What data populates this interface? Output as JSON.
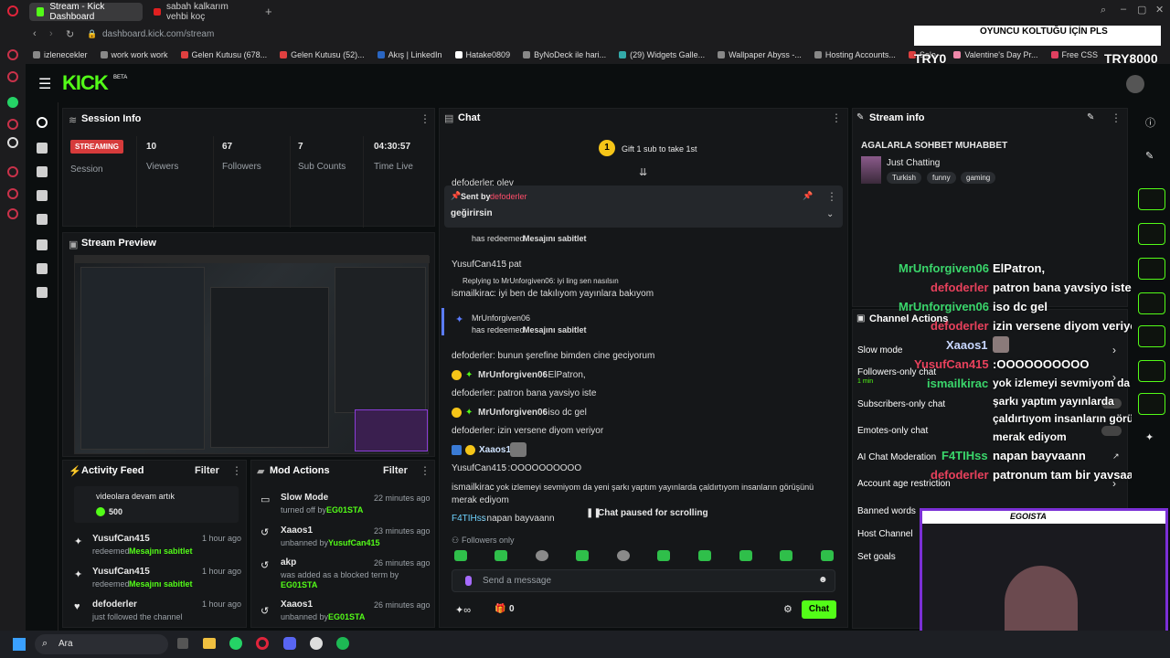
{
  "browser": {
    "tabs": [
      {
        "label": "Stream - Kick Dashboard"
      },
      {
        "label": "sabah kalkarım vehbi koç"
      }
    ],
    "url_host": "dashboard.kick.com",
    "url_path": "/stream",
    "bookmarks": [
      "izlenecekler",
      "work work work",
      "Gelen Kutusu (678...",
      "Gelen Kutusu (52)...",
      "Akış | LinkedIn",
      "Hatake0809",
      "ByNoDeck ile hari...",
      "(29) Widgets Galle...",
      "Wallpaper Abyss -...",
      "Hosting Accounts...",
      "Solo -",
      "Valentine's Day Pr...",
      "Free CSS"
    ]
  },
  "overlay_top": {
    "banner": "OYUNCU KOLTUĞU İÇİN PLS",
    "left": "TRY0",
    "right": "TRY8000"
  },
  "logo": {
    "text": "KICK",
    "beta": "BETA"
  },
  "session": {
    "title": "Session Info",
    "badge": "STREAMING",
    "session_label": "Session",
    "stats": [
      {
        "value": "10",
        "label": "Viewers"
      },
      {
        "value": "67",
        "label": "Followers"
      },
      {
        "value": "7",
        "label": "Sub Counts"
      },
      {
        "value": "04:30:57",
        "label": "Time Live"
      }
    ]
  },
  "preview": {
    "title": "Stream Preview"
  },
  "activity": {
    "title": "Activity Feed",
    "filter": "Filter",
    "top_text": "videolara devam artık",
    "top_amount": "500",
    "items": [
      {
        "name": "YusufCan415",
        "action": "redeemed",
        "reward": "Mesajını sabitlet",
        "time": "1 hour ago"
      },
      {
        "name": "YusufCan415",
        "action": "redeemed",
        "reward": "Mesajını sabitlet",
        "time": "1 hour ago"
      },
      {
        "name": "defoderler",
        "action": "just followed the channel",
        "reward": "",
        "time": "1 hour ago"
      }
    ]
  },
  "mod": {
    "title": "Mod Actions",
    "filter": "Filter",
    "items": [
      {
        "name": "Slow Mode",
        "line": "turned off by",
        "by": "EG01STA",
        "time": "22 minutes ago"
      },
      {
        "name": "Xaaos1",
        "line": "unbanned by",
        "by": "YusufCan415",
        "time": "23 minutes ago"
      },
      {
        "name": "akp",
        "line": "was added as a blocked term by",
        "by": "EG01STA",
        "time": "26 minutes ago"
      },
      {
        "name": "Xaaos1",
        "line": "unbanned by",
        "by": "EG01STA",
        "time": "26 minutes ago"
      }
    ]
  },
  "chat": {
    "title": "Chat",
    "gift_count": "1",
    "gift_text": "Gift 1 sub to take 1st",
    "partial_user": "defoderler",
    "partial_text": ": olev",
    "pinned_by_label": "Sent by",
    "pinned_by": "defoderler",
    "pinned_text": "geğirirsin",
    "redeem1_text": "has redeemed",
    "redeem1_reward": "Mesajını sabitlet",
    "messages": [
      {
        "user": "YusufCan415",
        "text": ": pat"
      },
      {
        "reply": "Replying to MrUnforgiven06: iyi ling sen nasılsın"
      },
      {
        "user": "ismailkirac",
        "text": ": iyi ben de takılıyom yayınlara bakıyom"
      }
    ],
    "redeem2_user": "MrUnforgiven06",
    "redeem2_text": "has redeemed",
    "redeem2_reward": "Mesajını sabitlet",
    "messages2": [
      {
        "user": "defoderler",
        "text": ": bunun şerefine bimden cine geciyorum"
      },
      {
        "user": "MrUnforgiven06",
        "text": ": ElPatron,"
      },
      {
        "user": "defoderler",
        "text": ": patron bana yavsiyo iste"
      },
      {
        "user": "MrUnforgiven06",
        "text": ": iso dc gel"
      },
      {
        "user": "defoderler",
        "text": ": izin versene diyom veriyor"
      },
      {
        "user": "Xaaos1",
        "text": ":"
      },
      {
        "user": "YusufCan415",
        "text": ": :OOOOOOOOOO"
      },
      {
        "user": "ismailkirac",
        "text": ": yok izlemeyi sevmiyom da yeni şarkı yaptım yayınlarda çaldırtıyom insanların görüşünü"
      },
      {
        "cont": "merak ediyom"
      },
      {
        "user": "F4TIHss",
        "text": ": napan bayvaann"
      }
    ],
    "paused": "Chat paused for scrolling",
    "followers_only": "Followers only",
    "placeholder": "Send a message",
    "count": "0",
    "send": "Chat"
  },
  "stream_info": {
    "title": "Stream info",
    "stream_title": "AGALARLA SOHBET MUHABBET",
    "category": "Just Chatting",
    "tags": [
      "Turkish",
      "funny",
      "gaming"
    ]
  },
  "overlay_chat": [
    {
      "user": "MrUnforgiven06",
      "text": "ElPatron,"
    },
    {
      "user": "defoderler",
      "text": "patron bana yavsiyo iste"
    },
    {
      "user": "MrUnforgiven06",
      "text": "iso dc gel"
    },
    {
      "user": "defoderler",
      "text": "izin versene diyom veriyor"
    },
    {
      "user": "Xaaos1",
      "text": ""
    },
    {
      "user": "YusufCan415",
      "text": ":OOOOOOOOOO"
    },
    {
      "user": "ismailkirac",
      "text": "yok izlemeyi sevmiyom da yeni"
    },
    {
      "user": "",
      "text": "şarkı yaptım yayınlarda"
    },
    {
      "user": "",
      "text": "çaldırtıyom insanların görüşünü"
    },
    {
      "user": "",
      "text": "merak ediyom"
    },
    {
      "user": "F4TIHss",
      "text": "napan bayvaann"
    },
    {
      "user": "defoderler",
      "text": "patronum tam bir yavsaak"
    }
  ],
  "channel_actions": {
    "title": "Channel Actions",
    "items": [
      "Slow mode",
      "Followers-only chat",
      "Subscribers-only chat",
      "Emotes-only chat",
      "AI Chat Moderation",
      "Account age restriction",
      "Banned words",
      "Host Channel",
      "Set goals"
    ],
    "followers_sub": "1 min"
  },
  "webcam": {
    "name": "EGOISTA"
  },
  "taskbar": {
    "search": "Ara"
  }
}
